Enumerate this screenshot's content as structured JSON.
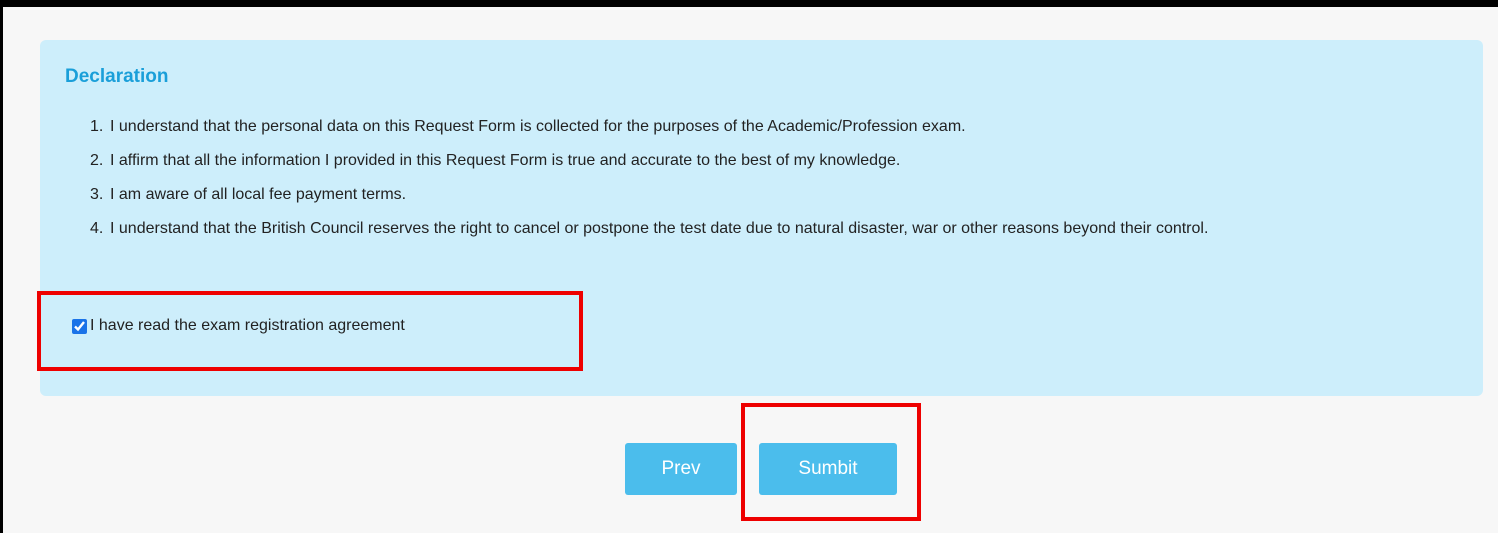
{
  "declaration": {
    "title": "Declaration",
    "items": [
      {
        "num": "1.",
        "text": "I understand that the personal data on this Request Form is collected for the purposes of the Academic/Profession exam."
      },
      {
        "num": "2.",
        "text": "I affirm that all the information I provided in this Request Form is true and accurate to the best of my knowledge."
      },
      {
        "num": "3.",
        "text": "I am aware of all local fee payment terms."
      },
      {
        "num": "4.",
        "text": "I understand that the British Council reserves the right to cancel or postpone the test date due to natural disaster, war or other reasons beyond their control."
      }
    ],
    "agreement_label": "I have read the exam registration agreement",
    "agreement_checked": true
  },
  "buttons": {
    "prev_label": "Prev",
    "submit_label": "Sumbit"
  },
  "colors": {
    "panel_bg": "#cdeefb",
    "title": "#1a9fd9",
    "button_bg": "#4bbdec",
    "highlight": "#ee0000"
  }
}
